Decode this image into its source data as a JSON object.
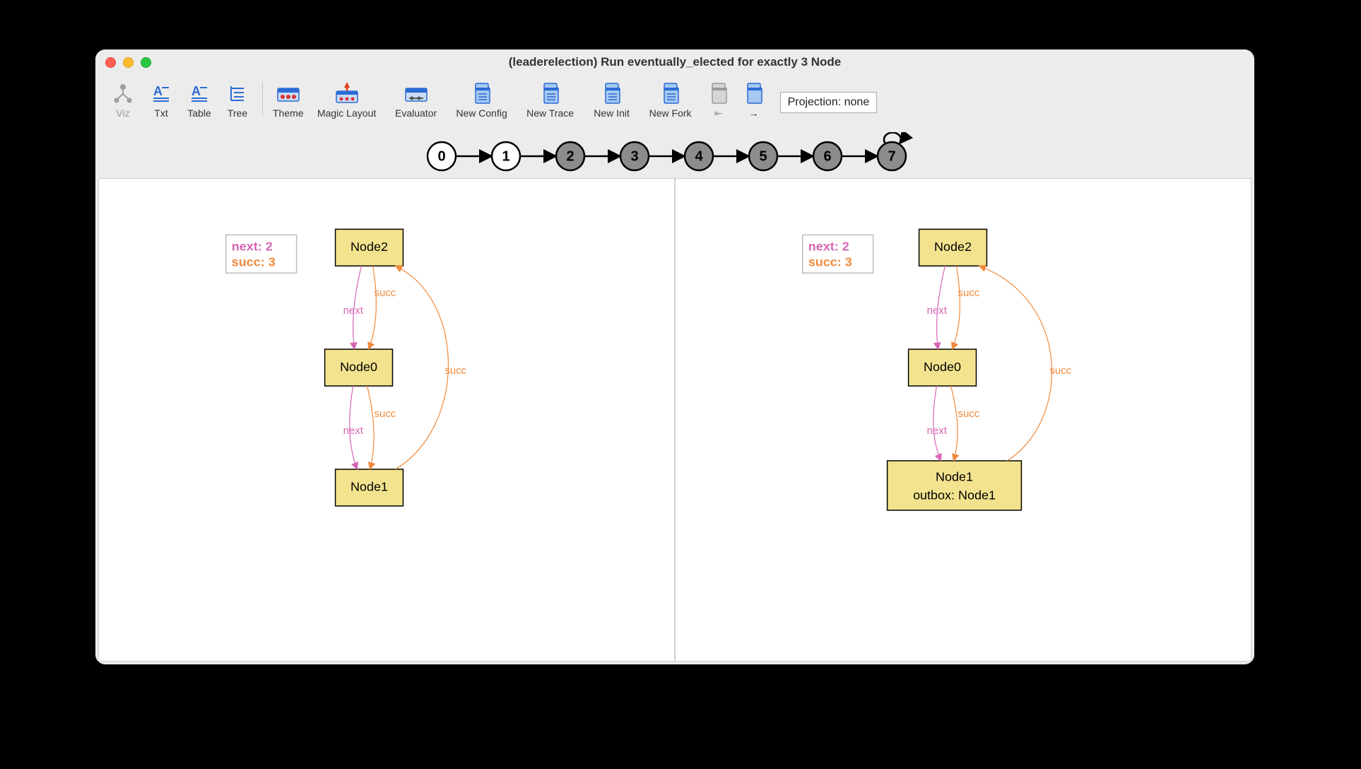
{
  "window": {
    "title": "(leaderelection) Run eventually_elected for exactly 3 Node"
  },
  "toolbar": {
    "viz": "Viz",
    "txt": "Txt",
    "table": "Table",
    "tree": "Tree",
    "theme": "Theme",
    "magic": "Magic Layout",
    "evaluator": "Evaluator",
    "newconfig": "New Config",
    "newtrace": "New Trace",
    "newinit": "New Init",
    "newfork": "New Fork",
    "back": "⇤",
    "fwd": "→",
    "projection_label": "Projection: none"
  },
  "trace": {
    "states": [
      "0",
      "1",
      "2",
      "3",
      "4",
      "5",
      "6",
      "7"
    ],
    "selected": [
      0,
      1
    ],
    "loop_at": 7
  },
  "legend": {
    "next_label": "next: 2",
    "succ_label": "succ: 3"
  },
  "edge_labels": {
    "next": "next",
    "succ": "succ"
  },
  "left": {
    "nodes": {
      "n2": "Node2",
      "n0": "Node0",
      "n1": "Node1"
    }
  },
  "right": {
    "nodes": {
      "n2": "Node2",
      "n0": "Node0",
      "n1_line1": "Node1",
      "n1_line2": "outbox: Node1"
    }
  }
}
